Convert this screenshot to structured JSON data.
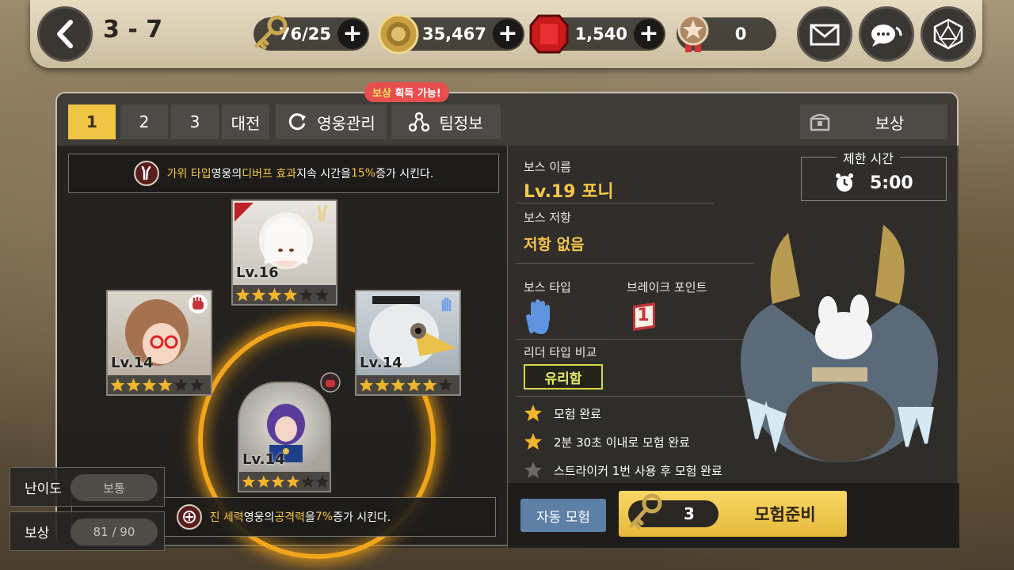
{
  "header": {
    "stage": "3 - 7",
    "resources": [
      {
        "name": "key",
        "value": "76/25",
        "has_plus": true
      },
      {
        "name": "gold",
        "value": "35,467",
        "has_plus": true
      },
      {
        "name": "ruby",
        "value": "1,540",
        "has_plus": true
      },
      {
        "name": "medal",
        "value": "0",
        "has_plus": false
      }
    ]
  },
  "tabs": {
    "t1": "1",
    "t2": "2",
    "t3": "3",
    "t4": "대전",
    "t5": "영웅관리",
    "t6": "팀정보",
    "reward": "보상"
  },
  "reward_tag": {
    "hl": "보상",
    "rest": " 획득 가능!"
  },
  "buff_top": {
    "a": "가위 타입",
    "b": " 영웅의 ",
    "c": "디버프 효과",
    "d": " 지속 시간을 ",
    "e": "15%",
    "f": "증가 시킨다."
  },
  "buff_bottom": {
    "a": "진 세력",
    "b": " 영웅의 ",
    "c": "공격력",
    "d": "을 ",
    "e": "7%",
    "f": "증가 시킨다."
  },
  "heroes": [
    {
      "level": "Lv.16",
      "stars": 4
    },
    {
      "level": "Lv.14",
      "stars": 4
    },
    {
      "level": "Lv.14",
      "stars": 5
    },
    {
      "level": "Lv.14",
      "stars": 4
    }
  ],
  "side": {
    "difficulty_label": "난이도",
    "difficulty_value": "보통",
    "reward_label": "보상",
    "reward_value": "81 / 90"
  },
  "boss": {
    "name_label": "보스 이름",
    "name": "Lv.19 포니",
    "resist_label": "보스 저항",
    "resist": "저항 없음",
    "type_label": "보스 타입",
    "break_label": "브레이크 포인트",
    "break_value": "1",
    "leader_label": "리더 타입 비교",
    "leader_value": "유리함",
    "limit_label": "제한 시간",
    "limit_value": "5:00"
  },
  "missions": [
    {
      "text": "모험 완료",
      "done": true
    },
    {
      "text": "2분 30초 이내로 모험 완료",
      "done": true
    },
    {
      "text": "스트라이커 1번 사용 후 모험 완료",
      "done": false
    }
  ],
  "actions": {
    "auto": "자동 모험",
    "cost": "3",
    "ready": "모험준비"
  },
  "colors": {
    "accent": "#f0c545",
    "highlight": "#f5c84a",
    "auto_button": "#5e7fa6"
  }
}
